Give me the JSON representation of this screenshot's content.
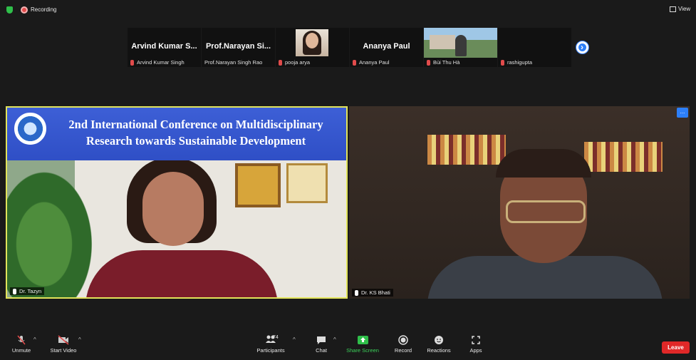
{
  "topbar": {
    "recording_label": "Recording",
    "view_label": "View"
  },
  "participants_strip": [
    {
      "big_name": "Arvind Kumar S...",
      "name": "Arvind Kumar Singh"
    },
    {
      "big_name": "Prof.Narayan Si...",
      "name": "Prof.Narayan Singh Rao"
    },
    {
      "big_name": "",
      "name": "pooja arya"
    },
    {
      "big_name": "Ananya Paul",
      "name": "Ananya Paul"
    },
    {
      "big_name": "",
      "name": "Bùi Thu Hà"
    },
    {
      "big_name": "",
      "name": "rashigupta"
    }
  ],
  "tiles": {
    "left": {
      "banner_line1": "2nd International Conference on Multidisciplinary",
      "banner_line2": "Research towards Sustainable Development",
      "name": "Dr. Tazyn"
    },
    "right": {
      "name": "Dr. KS Bhati",
      "more_label": "..."
    }
  },
  "toolbar": {
    "unmute": "Unmute",
    "start_video": "Start Video",
    "participants": "Participants",
    "participant_count": "74",
    "chat": "Chat",
    "share_screen": "Share Screen",
    "record": "Record",
    "reactions": "Reactions",
    "apps": "Apps",
    "leave": "Leave"
  },
  "colors": {
    "share_green": "#2fbf4a",
    "leave_red": "#e02828",
    "active_speaker_border": "#e2e45a",
    "banner_blue": "#3557cf"
  }
}
